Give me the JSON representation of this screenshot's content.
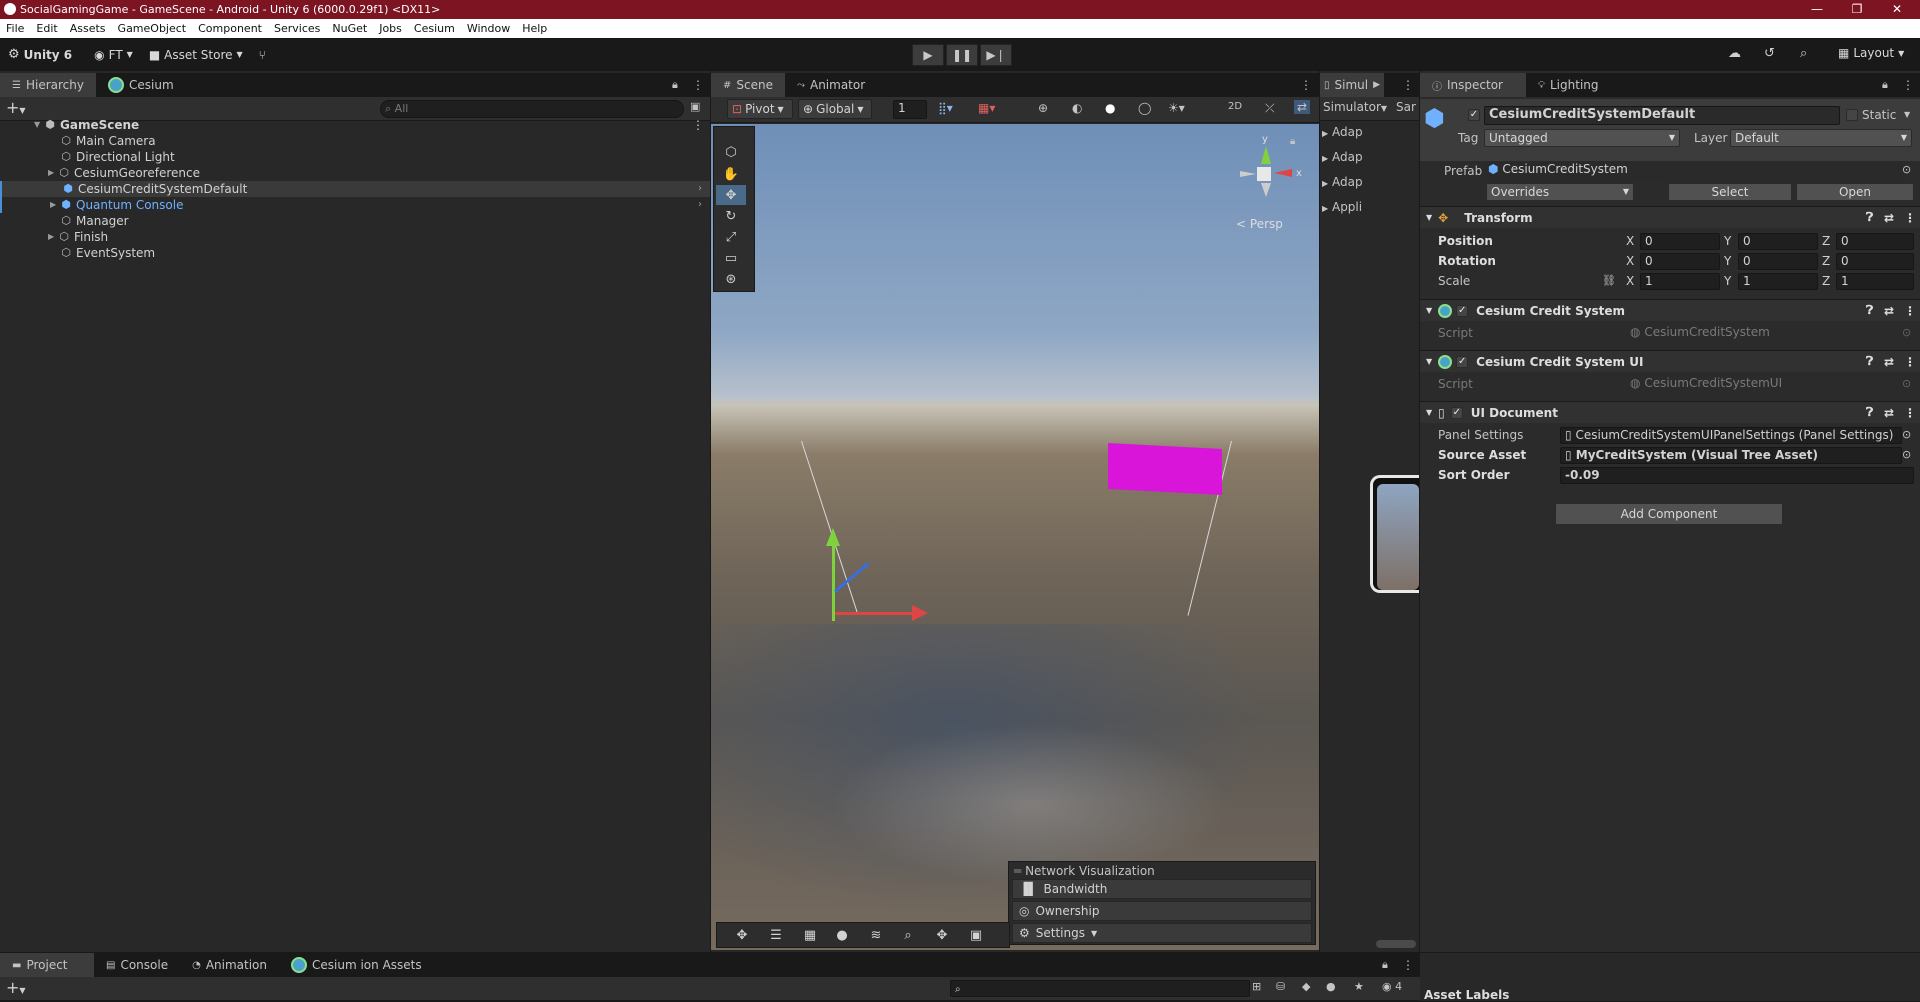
{
  "titlebar": {
    "title": "SocialGamingGame - GameScene - Android - Unity 6 (6000.0.29f1) <DX11>",
    "minimize": "—",
    "restore": "❐",
    "close": "✕"
  },
  "menu": [
    "File",
    "Edit",
    "Assets",
    "GameObject",
    "Component",
    "Services",
    "NuGet",
    "Jobs",
    "Cesium",
    "Window",
    "Help"
  ],
  "toolbar": {
    "unity_label": "Unity 6",
    "account_label": "FT",
    "asset_store_label": "Asset Store",
    "layout_label": "Layout"
  },
  "hierarchy": {
    "tabs": [
      "Hierarchy",
      "Cesium"
    ],
    "search_placeholder": "All",
    "scene_name": "GameScene",
    "items": [
      {
        "label": "Main Camera"
      },
      {
        "label": "Directional Light"
      },
      {
        "label": "CesiumGeoreference"
      },
      {
        "label": "CesiumCreditSystemDefault"
      },
      {
        "label": "Quantum Console"
      },
      {
        "label": "Manager"
      },
      {
        "label": "Finish"
      },
      {
        "label": "EventSystem"
      }
    ]
  },
  "scene": {
    "tabs": [
      "Scene",
      "Animator"
    ],
    "pivot_label": "Pivot",
    "global_label": "Global",
    "grid_value": "1",
    "persp_label": "Persp",
    "gizmo_y": "y",
    "gizmo_x": "x",
    "network_viz": {
      "title": "Network Visualization",
      "items": [
        "Bandwidth",
        "Ownership",
        "Settings"
      ]
    }
  },
  "simulator": {
    "tab": "Simul",
    "toolbar_label": "Simulator",
    "toolbar_label2": "Sar",
    "rows": [
      "Adap",
      "Adap",
      "Adap",
      "Appli"
    ]
  },
  "inspector": {
    "tabs": [
      "Inspector",
      "Lighting"
    ],
    "object_name": "CesiumCreditSystemDefault",
    "static_label": "Static",
    "tag_label": "Tag",
    "tag_value": "Untagged",
    "layer_label": "Layer",
    "layer_value": "Default",
    "prefab_label": "Prefab",
    "prefab_value": "CesiumCreditSystem",
    "overrides_label": "Overrides",
    "select_label": "Select",
    "open_label": "Open",
    "transform": {
      "title": "Transform",
      "position_label": "Position",
      "rotation_label": "Rotation",
      "scale_label": "Scale",
      "position": [
        "0",
        "0",
        "0"
      ],
      "rotation": [
        "0",
        "0",
        "0"
      ],
      "scale": [
        "1",
        "1",
        "1"
      ]
    },
    "components": [
      {
        "title": "Cesium Credit System",
        "script_label": "Script",
        "script_value": "CesiumCreditSystem"
      },
      {
        "title": "Cesium Credit System UI",
        "script_label": "Script",
        "script_value": "CesiumCreditSystemUI"
      }
    ],
    "ui_document": {
      "title": "UI Document",
      "panel_settings_label": "Panel Settings",
      "panel_settings_value": "CesiumCreditSystemUIPanelSettings (Panel Settings)",
      "source_asset_label": "Source Asset",
      "source_asset_value": "MyCreditSystem (Visual Tree Asset)",
      "sort_order_label": "Sort Order",
      "sort_order_value": "-0.09"
    },
    "add_component_label": "Add Component",
    "asset_labels": "Asset Labels"
  },
  "bottom": {
    "tabs": [
      "Project",
      "Console",
      "Animation",
      "Cesium ion Assets"
    ],
    "count": "4"
  },
  "colors": {
    "titlebar": "#7c1521",
    "selection": "#2c5d87",
    "prefab_blue": "#6fb1ff"
  }
}
